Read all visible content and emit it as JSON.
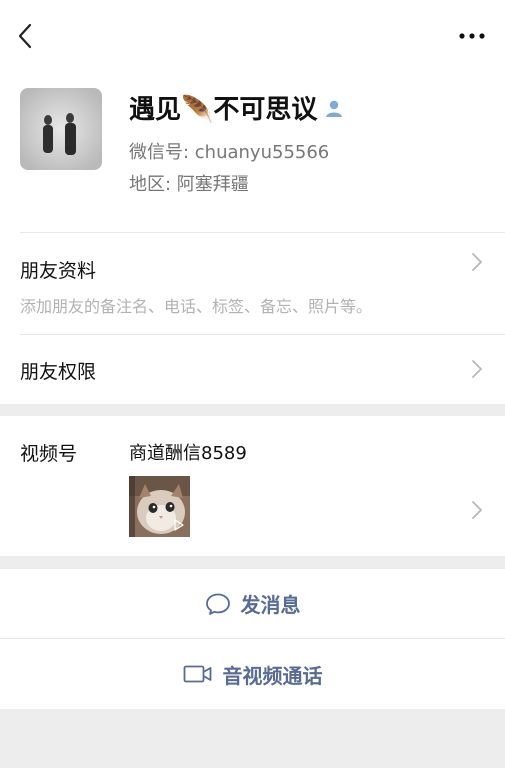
{
  "header": {
    "back_icon": "chevron-left-icon",
    "more_icon": "more-dots-icon"
  },
  "profile": {
    "name": "遇见🪶不可思议",
    "gender_icon": "person-icon",
    "wechat_id": "微信号: chuanyu55566",
    "region": "地区: 阿塞拜疆"
  },
  "friend_info": {
    "title": "朋友资料",
    "subtitle": "添加朋友的备注名、电话、标签、备忘、照片等。"
  },
  "friend_permissions": {
    "title": "朋友权限"
  },
  "channels": {
    "label": "视频号",
    "channel_name": "商道酬信8589"
  },
  "actions": {
    "message_label": "发消息",
    "call_label": "音视频通话"
  },
  "colors": {
    "link": "#576b95",
    "background": "#ededed"
  }
}
